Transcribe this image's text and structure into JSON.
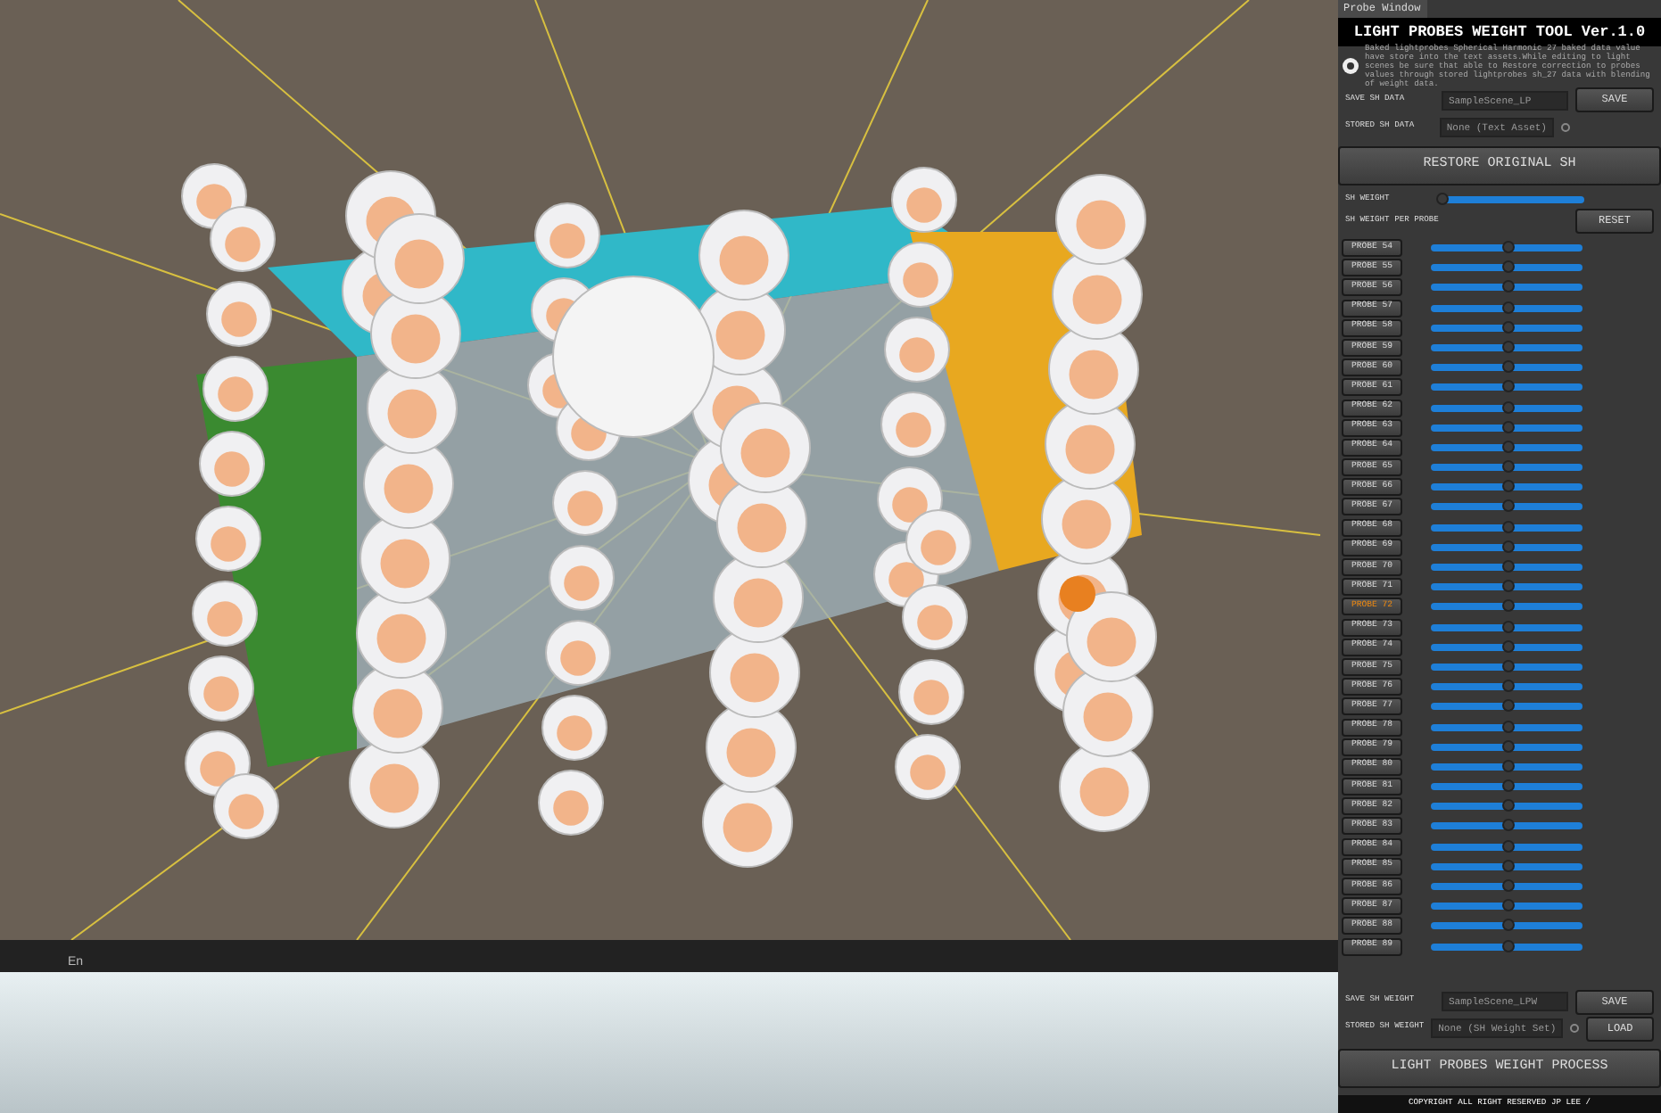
{
  "viewport": {
    "status_text": "En"
  },
  "panel": {
    "tab": "Probe Window",
    "title": "LIGHT PROBES WEIGHT TOOL Ver.1.0",
    "info": "Baked lightprobes Spherical Harmonic 27 baked data value have store into the text assets.While editing to light scenes be sure that able to Restore correction to probes values through stored lightprobes sh_27 data with blending of weight data.",
    "save_sh_data": {
      "label": "SAVE SH DATA",
      "value": "SampleScene_LP",
      "button": "SAVE"
    },
    "stored_sh_data": {
      "label": "STORED SH DATA",
      "value": "None (Text Asset)"
    },
    "restore_button": "RESTORE ORIGINAL SH",
    "sh_weight": {
      "label": "SH WEIGHT",
      "level": 0
    },
    "per_probe": {
      "label": "SH WEIGHT PER PROBE",
      "button": "RESET"
    },
    "probes": [
      {
        "label": "PROBE 54",
        "selected": false,
        "level": 0.5
      },
      {
        "label": "PROBE 55",
        "selected": false,
        "level": 0.5
      },
      {
        "label": "PROBE 56",
        "selected": false,
        "level": 0.5
      },
      {
        "label": "PROBE 57",
        "selected": false,
        "level": 0.5
      },
      {
        "label": "PROBE 58",
        "selected": false,
        "level": 0.5
      },
      {
        "label": "PROBE 59",
        "selected": false,
        "level": 0.5
      },
      {
        "label": "PROBE 60",
        "selected": false,
        "level": 0.5
      },
      {
        "label": "PROBE 61",
        "selected": false,
        "level": 0.5
      },
      {
        "label": "PROBE 62",
        "selected": false,
        "level": 0.5
      },
      {
        "label": "PROBE 63",
        "selected": false,
        "level": 0.5
      },
      {
        "label": "PROBE 64",
        "selected": false,
        "level": 0.5
      },
      {
        "label": "PROBE 65",
        "selected": false,
        "level": 0.5
      },
      {
        "label": "PROBE 66",
        "selected": false,
        "level": 0.5
      },
      {
        "label": "PROBE 67",
        "selected": false,
        "level": 0.5
      },
      {
        "label": "PROBE 68",
        "selected": false,
        "level": 0.5
      },
      {
        "label": "PROBE 69",
        "selected": false,
        "level": 0.5
      },
      {
        "label": "PROBE 70",
        "selected": false,
        "level": 0.5
      },
      {
        "label": "PROBE 71",
        "selected": false,
        "level": 0.5
      },
      {
        "label": "PROBE 72",
        "selected": true,
        "level": 0.5
      },
      {
        "label": "PROBE 73",
        "selected": false,
        "level": 0.5
      },
      {
        "label": "PROBE 74",
        "selected": false,
        "level": 0.5
      },
      {
        "label": "PROBE 75",
        "selected": false,
        "level": 0.5
      },
      {
        "label": "PROBE 76",
        "selected": false,
        "level": 0.5
      },
      {
        "label": "PROBE 77",
        "selected": false,
        "level": 0.5
      },
      {
        "label": "PROBE 78",
        "selected": false,
        "level": 0.5
      },
      {
        "label": "PROBE 79",
        "selected": false,
        "level": 0.5
      },
      {
        "label": "PROBE 80",
        "selected": false,
        "level": 0.5
      },
      {
        "label": "PROBE 81",
        "selected": false,
        "level": 0.5
      },
      {
        "label": "PROBE 82",
        "selected": false,
        "level": 0.5
      },
      {
        "label": "PROBE 83",
        "selected": false,
        "level": 0.5
      },
      {
        "label": "PROBE 84",
        "selected": false,
        "level": 0.5
      },
      {
        "label": "PROBE 85",
        "selected": false,
        "level": 0.5
      },
      {
        "label": "PROBE 86",
        "selected": false,
        "level": 0.5
      },
      {
        "label": "PROBE 87",
        "selected": false,
        "level": 0.5
      },
      {
        "label": "PROBE 88",
        "selected": false,
        "level": 0.5
      },
      {
        "label": "PROBE 89",
        "selected": false,
        "level": 0.5
      }
    ],
    "save_sh_weight": {
      "label": "SAVE SH WEIGHT",
      "value": "SampleScene_LPW",
      "button": "SAVE"
    },
    "stored_sh_weight": {
      "label": "STORED SH WEIGHT",
      "value": "None (SH Weight Set)",
      "button": "LOAD"
    },
    "process_button": "LIGHT PROBES WEIGHT PROCESS",
    "copyright": "COPYRIGHT ALL RIGHT RESERVED JP LEE /"
  }
}
